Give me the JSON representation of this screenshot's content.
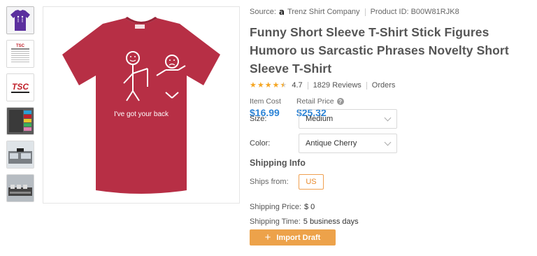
{
  "thumbnails": [
    {
      "name": "purple-shirt-thumbnail"
    },
    {
      "name": "size-chart-thumbnail"
    },
    {
      "name": "tsc-logo-thumbnail",
      "text": "TSC"
    },
    {
      "name": "color-swatch-thumbnail"
    },
    {
      "name": "storefront-thumbnail"
    },
    {
      "name": "printing-machine-thumbnail"
    }
  ],
  "main_image": {
    "shirt_color": "#b72f45",
    "shirt_text": "I've got your back"
  },
  "source": {
    "label": "Source:",
    "store": "Trenz Shirt Company",
    "product_id_label": "Product ID:",
    "product_id": "B00W81RJK8"
  },
  "title": "Funny Short Sleeve T-Shirt Stick Figures Humoro us Sarcastic Phrases Novelty Short Sleeve T-Shirt",
  "rating": {
    "value": 4.7,
    "score_text": "4.7",
    "reviews": "1829 Reviews",
    "orders": "Orders"
  },
  "prices": {
    "item_cost_label": "Item Cost",
    "item_cost": "$16.99",
    "retail_label": "Retail Price",
    "retail": "$25.32"
  },
  "options": {
    "size_label": "Size:",
    "size_value": "Medium",
    "color_label": "Color:",
    "color_value": "Antique Cherry"
  },
  "shipping": {
    "title": "Shipping Info",
    "ships_from_label": "Ships from:",
    "ships_from_value": "US",
    "price_label": "Shipping Price:",
    "price_value": "$ 0",
    "time_label": "Shipping Time:",
    "time_value": "5 business days"
  },
  "actions": {
    "import_label": "Import Draft"
  },
  "colors": {
    "accent_blue": "#2d84d6",
    "accent_orange": "#eda24a",
    "star": "#f5a623"
  }
}
